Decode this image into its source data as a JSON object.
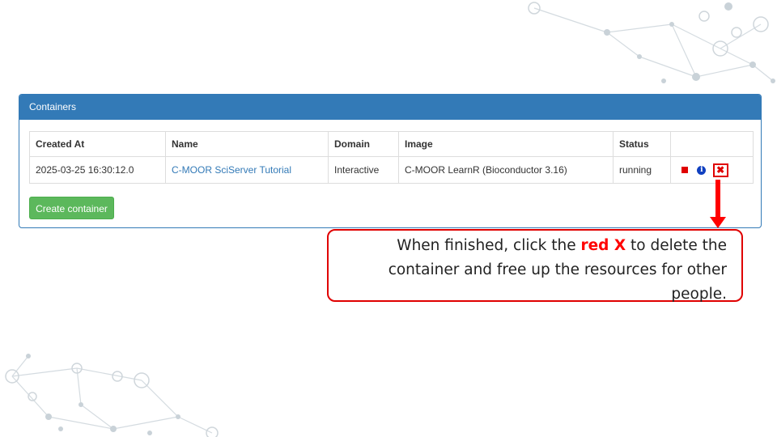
{
  "panel": {
    "heading": "Containers"
  },
  "table": {
    "headers": [
      "Created At",
      "Name",
      "Domain",
      "Image",
      "Status",
      ""
    ],
    "rows": [
      {
        "created_at": "2025-03-25 16:30:12.0",
        "name": "C-MOOR SciServer Tutorial",
        "domain": "Interactive",
        "image": "C-MOOR LearnR (Bioconductor 3.16)",
        "status": "running",
        "actions": {
          "stop_icon": "stop-square-icon",
          "info_icon": "info-circle-icon",
          "info_glyph": "i",
          "delete_icon": "close-x-icon",
          "delete_glyph": "✖"
        }
      }
    ]
  },
  "create_button": "Create container",
  "callout": {
    "text_before": "When finished, click the ",
    "highlight": "red X",
    "text_after": " to delete the container and free up the resources for other people."
  },
  "colors": {
    "primary": "#337ab7",
    "success": "#5cb85c",
    "annotation_red": "#ff0000"
  }
}
